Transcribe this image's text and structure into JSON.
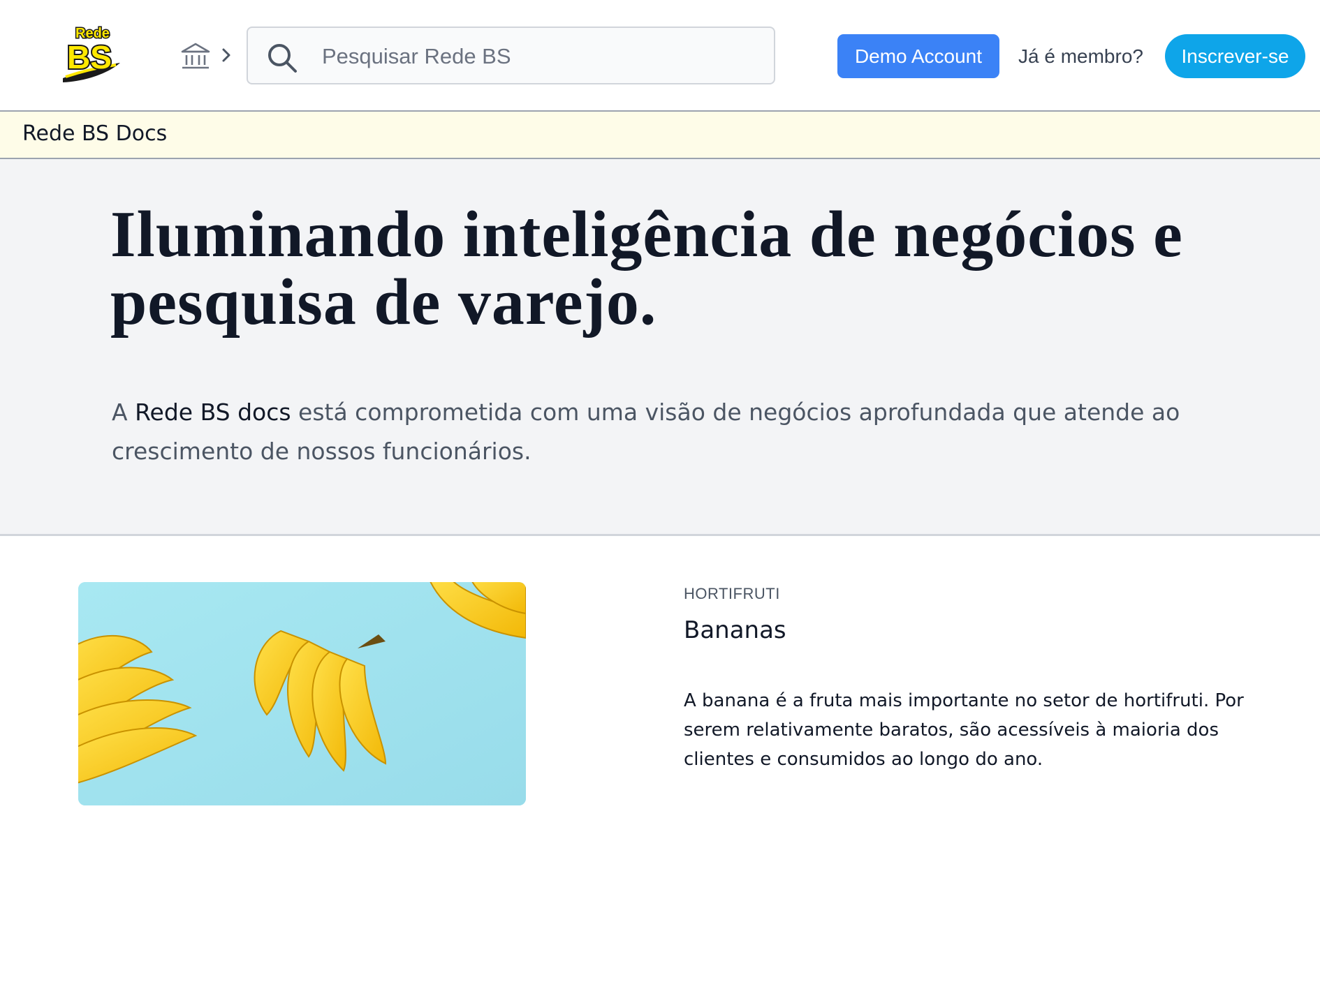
{
  "header": {
    "logo_text_top": "Rede",
    "logo_text_main": "BS",
    "home_icon": "bank-building-icon",
    "breadcrumb_icon": "chevron-right-icon",
    "search": {
      "placeholder": "Pesquisar Rede BS",
      "value": "",
      "icon": "search-icon"
    },
    "demo_button": "Demo Account",
    "member_link": "Já é membro?",
    "signup_button": "Inscrever-se"
  },
  "docs_bar": {
    "title": "Rede BS Docs"
  },
  "hero": {
    "title": "Iluminando inteligência de negócios e pesquisa de varejo.",
    "desc_prefix": "A ",
    "desc_strong": "Rede BS docs",
    "desc_rest": " está comprometida com uma visão de negócios aprofundada que atende ao crescimento de nossos funcionários."
  },
  "article": {
    "category": "HORTIFRUTI",
    "title": "Bananas",
    "body": "A banana é a fruta mais importante no setor de hortifruti. Por serem relativamente baratos, são acessíveis à maioria dos clientes e consumidos ao longo do ano.",
    "image": "bananas-on-blue-photo"
  },
  "colors": {
    "demo_button": "#3b82f6",
    "signup_button": "#0ea5e9",
    "docs_bar_bg": "#fefce8",
    "hero_bg": "#f3f4f6",
    "logo_yellow": "#ffe800"
  }
}
